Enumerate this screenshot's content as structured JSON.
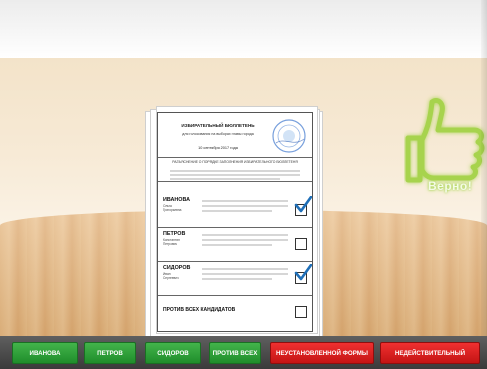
{
  "overlay": {
    "approval_text": "Верно!"
  },
  "ballot": {
    "title": "ИЗБИРАТЕЛЬНЫЙ БЮЛЛЕТЕНЬ",
    "subtitle": "для голосования на выборах главы города",
    "date": "10 сентября 2017 года",
    "instructions": "РАЗЪЯСНЕНИЕ О ПОРЯДКЕ ЗАПОЛНЕНИЯ ИЗБИРАТЕЛЬНОГО БЮЛЛЕТЕНЯ",
    "candidates": [
      {
        "surname": "ИВАНОВА",
        "name": "Ольга",
        "patronymic": "Григорьевна",
        "checked": true
      },
      {
        "surname": "ПЕТРОВ",
        "name": "Константин",
        "patronymic": "Петрович",
        "checked": false
      },
      {
        "surname": "СИДОРОВ",
        "name": "Иван",
        "patronymic": "Сергеевич",
        "checked": true
      }
    ],
    "against_all": {
      "label": "ПРОТИВ ВСЕХ КАНДИДАТОВ",
      "checked": false
    }
  },
  "bottom_bar": {
    "buttons": [
      {
        "label": "ИВАНОВА",
        "color": "#2aa136"
      },
      {
        "label": "ПЕТРОВ",
        "color": "#2aa136"
      },
      {
        "label": "СИДОРОВ",
        "color": "#2aa136"
      },
      {
        "label": "ПРОТИВ ВСЕХ",
        "color": "#2aa136"
      },
      {
        "label": "НЕУСТАНОВЛЕННОЙ ФОРМЫ",
        "color": "#e01f1f"
      },
      {
        "label": "НЕДЕЙСТВИТЕЛЬНЫЙ",
        "color": "#e01f1f"
      }
    ]
  },
  "colors": {
    "wall": "#f6e8d2",
    "floor": "#e4b57d",
    "approve_green": "#9ccd3f",
    "check_blue": "#1f6fb8",
    "stamp_blue": "#4a7fd0"
  }
}
